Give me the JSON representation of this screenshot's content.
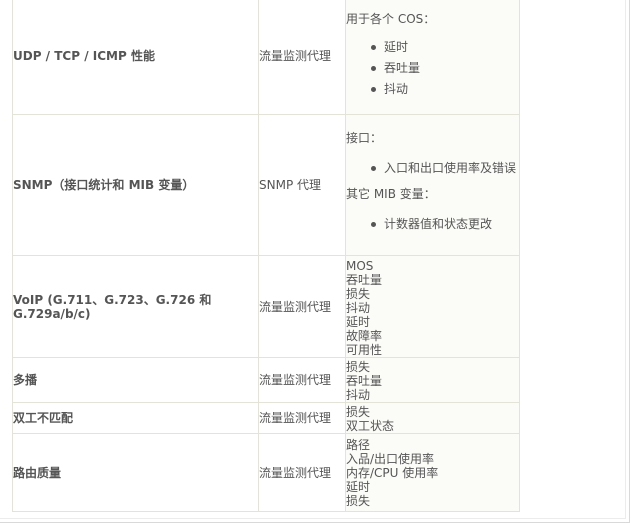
{
  "rows": [
    {
      "metric": "UDP / TCP / ICMP 性能",
      "agent": "流量监测代理",
      "heading": "用于各个 COS：",
      "bullets": [
        "延时",
        "吞吐量",
        "抖动"
      ]
    },
    {
      "metric": "SNMP（接口统计和 MIB 变量）",
      "agent": "SNMP 代理",
      "heading1": "接口：",
      "bullets1": [
        "入口和出口使用率及错误"
      ],
      "heading2": "其它 MIB 变量：",
      "bullets2": [
        "计数器值和状态更改"
      ]
    },
    {
      "metric": "VoIP (G.711、G.723、G.726 和 G.729a/b/c)",
      "agent": "流量监测代理",
      "lines": [
        "MOS",
        "吞吐量",
        "损失",
        "抖动",
        "延时",
        "故障率",
        "可用性"
      ]
    },
    {
      "metric": "多播",
      "agent": "流量监测代理",
      "lines": [
        "损失",
        "吞吐量",
        "抖动"
      ]
    },
    {
      "metric": "双工不匹配",
      "agent": "流量监测代理",
      "lines": [
        "损失",
        "双工状态"
      ]
    },
    {
      "metric": "路由质量",
      "agent": "流量监测代理",
      "lines": [
        "路径",
        "入品/出口使用率",
        "内存/CPU 使用率",
        "延时",
        "损失"
      ]
    }
  ]
}
